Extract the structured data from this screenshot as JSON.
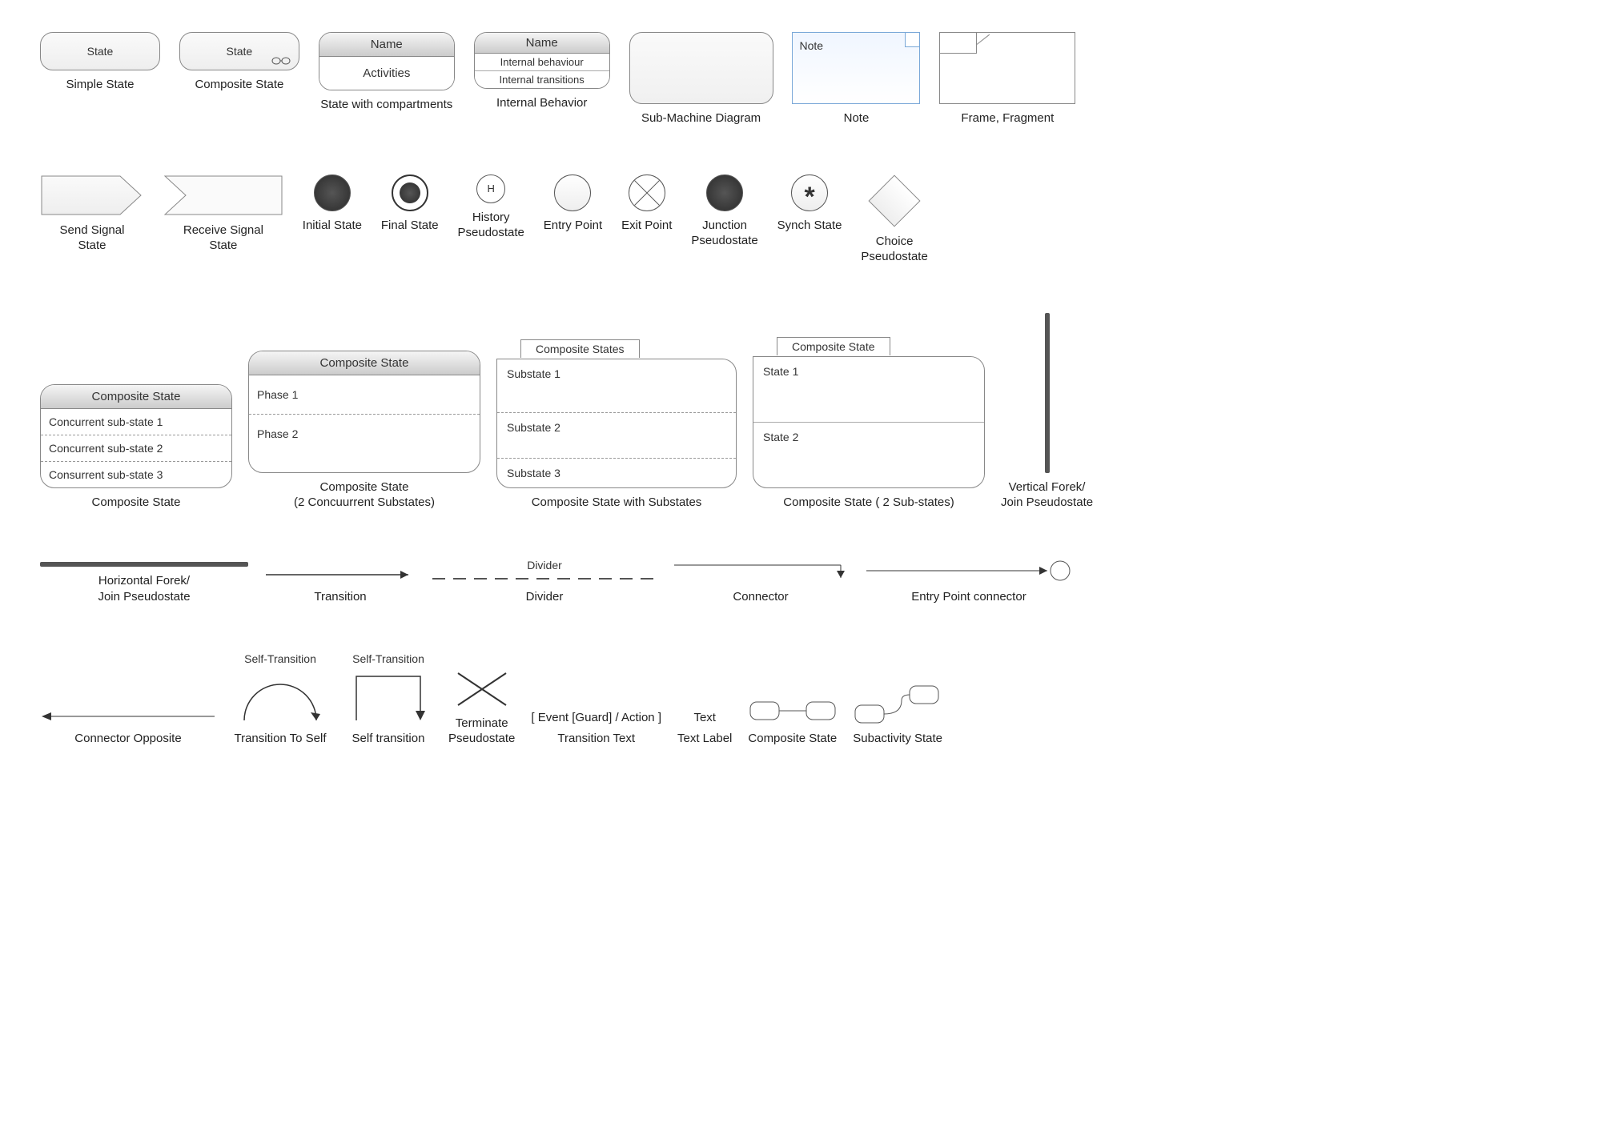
{
  "row1": {
    "simple": {
      "text": "State",
      "caption": "Simple State"
    },
    "composite": {
      "text": "State",
      "caption": "Composite State"
    },
    "compartments": {
      "name": "Name",
      "activities": "Activities",
      "caption": "State with compartments"
    },
    "internal": {
      "name": "Name",
      "r1": "Internal behaviour",
      "r2": "Internal transitions",
      "caption": "Internal Behavior"
    },
    "submachine": {
      "caption": "Sub-Machine Diagram"
    },
    "note": {
      "text": "Note",
      "caption": "Note"
    },
    "frame": {
      "caption": "Frame, Fragment"
    }
  },
  "row2": {
    "send": {
      "caption": "Send Signal\nState"
    },
    "receive": {
      "caption": "Receive Signal\nState"
    },
    "initial": {
      "caption": "Initial State"
    },
    "final": {
      "caption": "Final State"
    },
    "history": {
      "letter": "H",
      "caption": "History\nPseudostate"
    },
    "entry": {
      "caption": "Entry Point"
    },
    "exit": {
      "caption": "Exit Point"
    },
    "junction": {
      "caption": "Junction\nPseudostate"
    },
    "synch": {
      "star": "*",
      "caption": "Synch State"
    },
    "choice": {
      "caption": "Choice\nPseudostate"
    }
  },
  "row3": {
    "cs1": {
      "hdr": "Composite State",
      "s1": "Concurrent sub-state 1",
      "s2": "Concurrent sub-state 2",
      "s3": "Consurrent sub-state 3",
      "caption": "Composite State"
    },
    "cs2": {
      "hdr": "Composite State",
      "s1": "Phase 1",
      "s2": "Phase 2",
      "caption": "Composite State\n(2 Concuurrent Substates)"
    },
    "cs3": {
      "tab": "Composite States",
      "s1": "Substate 1",
      "s2": "Substate 2",
      "s3": "Substate 3",
      "caption": "Composite State with Substates"
    },
    "cs4": {
      "tab": "Composite State",
      "s1": "State 1",
      "s2": "State 2",
      "caption": "Composite State ( 2 Sub-states)"
    },
    "vfork": {
      "caption": "Vertical Forek/\nJoin Pseudostate"
    }
  },
  "row4": {
    "hfork": {
      "caption": "Horizontal Forek/\nJoin Pseudostate"
    },
    "transition": {
      "caption": "Transition"
    },
    "divider": {
      "label": "Divider",
      "caption": "Divider"
    },
    "connector": {
      "caption": "Connector"
    },
    "entryconn": {
      "caption": "Entry Point connector"
    }
  },
  "row5": {
    "connopp": {
      "caption": "Connector Opposite"
    },
    "trself": {
      "label": "Self-Transition",
      "caption": "Transition To Self"
    },
    "selftr": {
      "label": "Self-Transition",
      "caption": "Self transition"
    },
    "terminate": {
      "caption": "Terminate\nPseudostate"
    },
    "trtext": {
      "text": "[ Event [Guard] / Action ]",
      "caption": "Transition Text"
    },
    "textlabel": {
      "text": "Text",
      "caption": "Text Label"
    },
    "compstate": {
      "caption": "Composite State"
    },
    "subactivity": {
      "caption": "Subactivity State"
    }
  }
}
